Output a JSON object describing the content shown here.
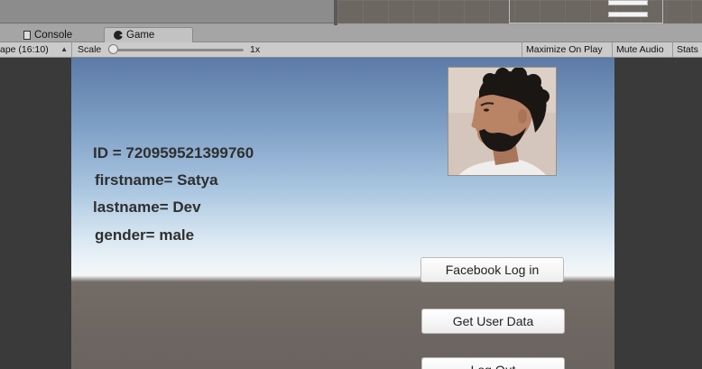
{
  "tabs": {
    "console": "Console",
    "game": "Game"
  },
  "toolbar": {
    "aspect": "ape (16:10)",
    "scale_label": "Scale",
    "scale_value": "1x",
    "maximize_on_play": "Maximize On Play",
    "mute_audio": "Mute Audio",
    "stats": "Stats"
  },
  "game": {
    "id_line": "ID = 720959521399760",
    "firstname_line": "firstname= Satya",
    "lastname_line": "lastname= Dev",
    "gender_line": "gender= male",
    "buttons": {
      "facebook_login": "Facebook Log in",
      "get_user_data": "Get User Data",
      "log_out": "Log Out"
    }
  },
  "colors": {
    "editor_bg": "#393939",
    "toolbar_bg": "#cbcbcb",
    "sky_top": "#5c7aa6",
    "ground": "#6e6762"
  }
}
